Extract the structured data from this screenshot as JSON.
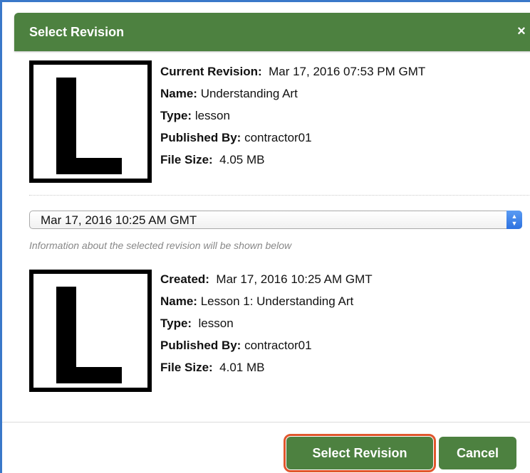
{
  "dialog": {
    "title": "Select Revision",
    "close_symbol": "×"
  },
  "current_revision": {
    "thumbnail_letter": "L",
    "fields": [
      {
        "label": "Current Revision:",
        "value": "Mar 17, 2016 07:53 PM GMT"
      },
      {
        "label": "Name:",
        "value": "Understanding Art"
      },
      {
        "label": "Type:",
        "value": "lesson"
      },
      {
        "label": "Published By:",
        "value": "contractor01"
      },
      {
        "label": "File Size:",
        "value": "4.05 MB"
      }
    ]
  },
  "revision_select": {
    "selected_value": "Mar 17, 2016 10:25 AM GMT",
    "helper_text": "Information about the selected revision will be shown below"
  },
  "selected_revision": {
    "thumbnail_letter": "L",
    "fields": [
      {
        "label": "Created:",
        "value": "Mar 17, 2016 10:25 AM GMT"
      },
      {
        "label": "Name:",
        "value": "Lesson 1: Understanding Art"
      },
      {
        "label": "Type:",
        "value": "lesson"
      },
      {
        "label": "Published By:",
        "value": "contractor01"
      },
      {
        "label": "File Size:",
        "value": "4.01 MB"
      }
    ]
  },
  "buttons": {
    "select_label": "Select Revision",
    "cancel_label": "Cancel"
  },
  "colors": {
    "header_green": "#4d8140",
    "highlight_outline": "#e0562d",
    "select_arrow_blue": "#2e72e0"
  }
}
